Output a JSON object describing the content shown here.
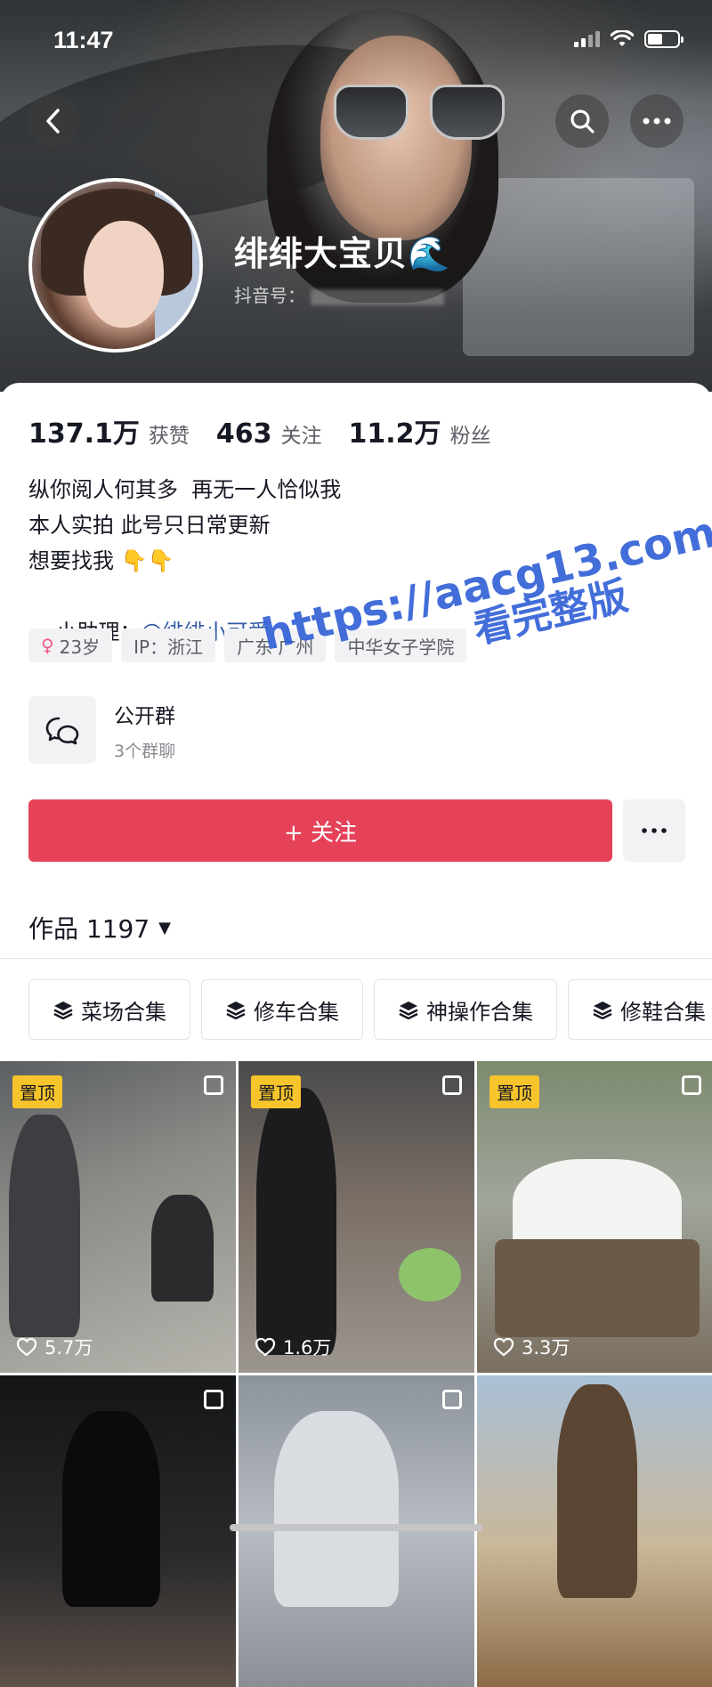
{
  "status_bar": {
    "time": "11:47"
  },
  "profile": {
    "name": "绯绯大宝贝🌊",
    "douyin_id_label": "抖音号："
  },
  "stats": [
    {
      "value": "137.1万",
      "label": "获赞"
    },
    {
      "value": "463",
      "label": "关注"
    },
    {
      "value": "11.2万",
      "label": "粉丝"
    }
  ],
  "bio": {
    "line1": "纵你阅人何其多  再无一人恰似我",
    "line2": "本人实拍 此号只日常更新",
    "line3": "想要找我 👇👇",
    "assistant_label": "小助理：",
    "assistant_mention": "@绯绯小可爱"
  },
  "tags": {
    "age": "23岁",
    "ip": "IP：浙江",
    "location": "广东·广州",
    "school": "中华女子学院"
  },
  "group": {
    "title": "公开群",
    "subtitle": "3个群聊"
  },
  "follow_button": "+ 关注",
  "works": {
    "label": "作品 1197"
  },
  "collections": [
    "菜场合集",
    "修车合集",
    "神操作合集",
    "修鞋合集"
  ],
  "videos": [
    {
      "pinned": true,
      "pin_label": "置顶",
      "likes": "5.7万"
    },
    {
      "pinned": true,
      "pin_label": "置顶",
      "likes": "1.6万"
    },
    {
      "pinned": true,
      "pin_label": "置顶",
      "likes": "3.3万"
    },
    {
      "pinned": false,
      "likes": ""
    },
    {
      "pinned": false,
      "likes": ""
    },
    {
      "pinned": false,
      "likes": ""
    }
  ],
  "watermark": {
    "url": "https://aacg13.com",
    "subtitle": "看完整版"
  },
  "icons": {
    "back": "chevron-left-icon",
    "search": "search-icon",
    "more": "more-dots-icon",
    "chat": "chat-bubble-icon",
    "layers": "layers-icon",
    "heart": "heart-icon"
  },
  "colors": {
    "follow": "#e5425a",
    "mention": "#2f59a6",
    "pin": "#f7c42c",
    "watermark": "#2f5fd6"
  }
}
